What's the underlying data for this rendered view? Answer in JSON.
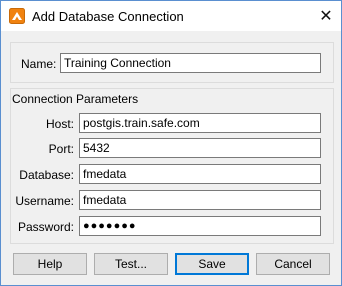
{
  "window": {
    "title": "Add Database Connection",
    "close_glyph": "✕",
    "icon": "fme-app-icon"
  },
  "name_group": {
    "name_label": "Name:",
    "name_value": "Training Connection"
  },
  "params_group": {
    "legend": "Connection Parameters",
    "host_label": "Host:",
    "host_value": "postgis.train.safe.com",
    "port_label": "Port:",
    "port_value": "5432",
    "database_label": "Database:",
    "database_value": "fmedata",
    "username_label": "Username:",
    "username_value": "fmedata",
    "password_label": "Password:",
    "password_value": "●●●●●●●"
  },
  "buttons": {
    "help": "Help",
    "test": "Test...",
    "save": "Save",
    "cancel": "Cancel"
  },
  "colors": {
    "accent": "#0078d7",
    "window_border": "#5a8fd0",
    "icon_orange": "#f0820f"
  }
}
